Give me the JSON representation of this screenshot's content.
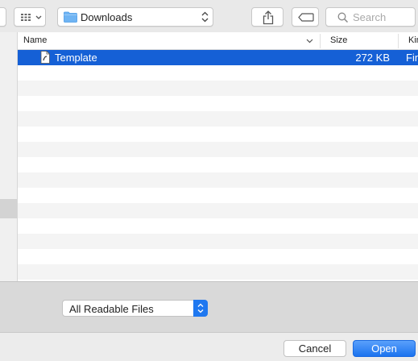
{
  "toolbar": {
    "path_label": "Downloads",
    "search_placeholder": "Search",
    "icons": [
      "grid-view-icon",
      "folder-icon",
      "share-icon",
      "tag-icon",
      "search-icon"
    ]
  },
  "list": {
    "columns": {
      "name": "Name",
      "size": "Size",
      "kind": "Kin"
    },
    "files": [
      {
        "name": "Template",
        "size": "272 KB",
        "kind": "Fin",
        "icon": "document-icon"
      }
    ]
  },
  "accessory": {
    "format_selected": "All Readable Files"
  },
  "footer": {
    "cancel_label": "Cancel",
    "open_label": "Open"
  },
  "colors": {
    "selection": "#1560d6",
    "accent": "#1f78f0"
  }
}
